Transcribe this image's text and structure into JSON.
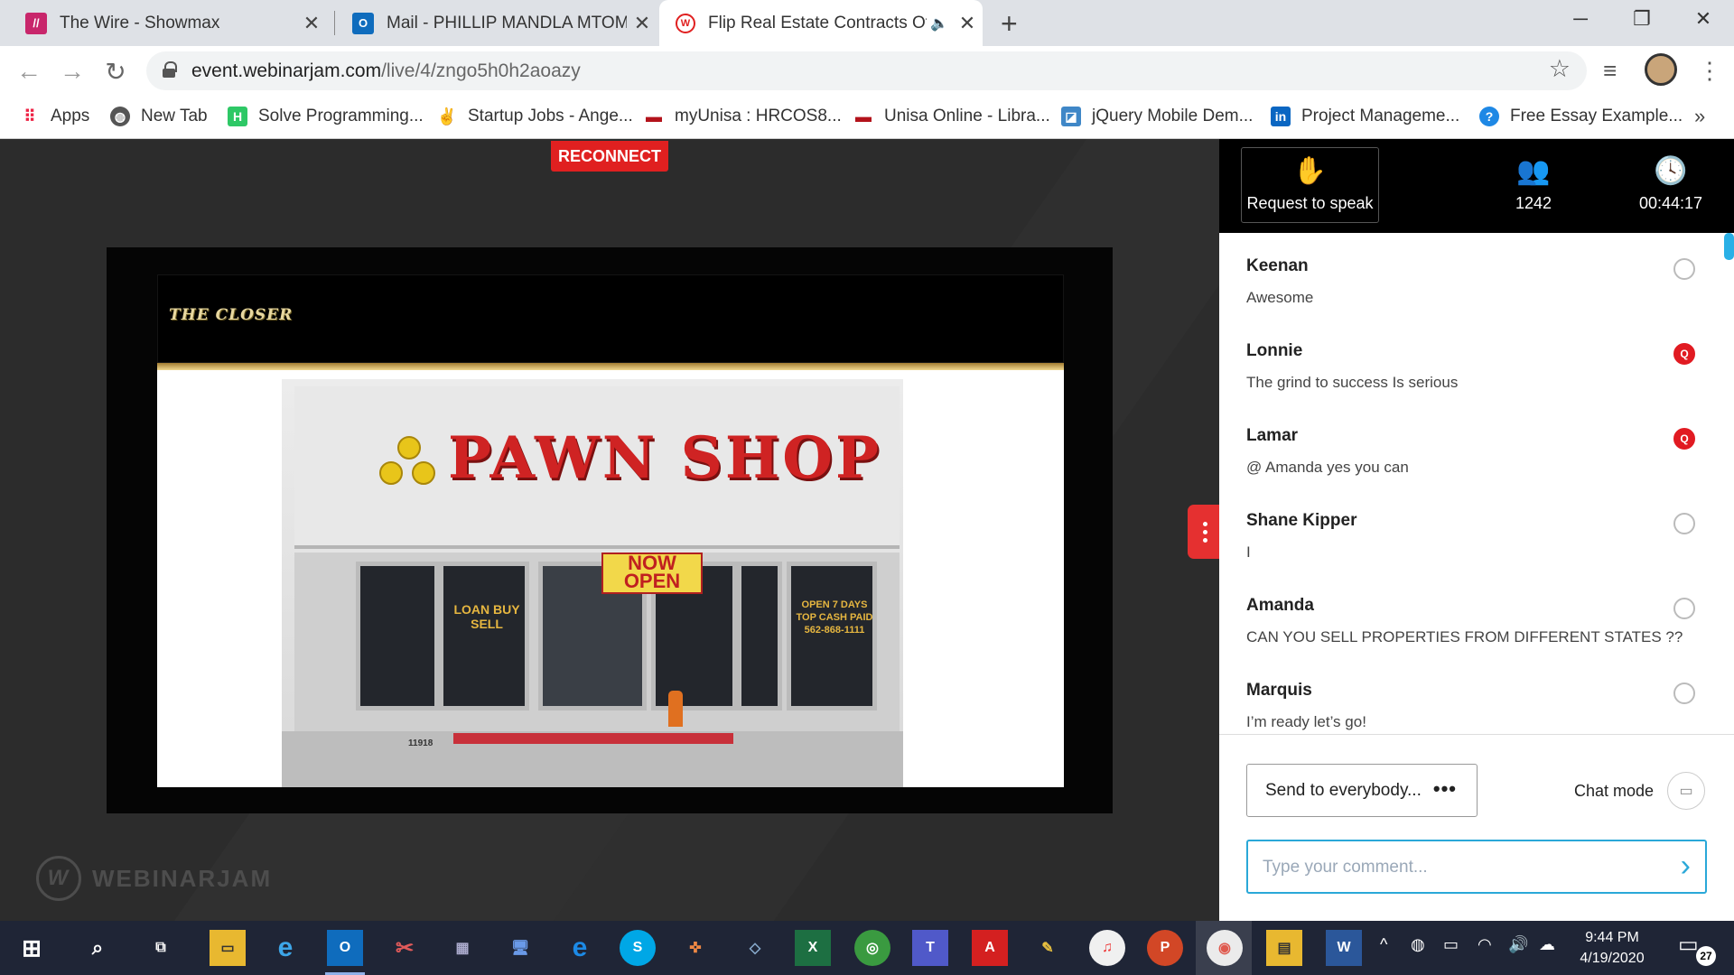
{
  "browser": {
    "tabs": [
      {
        "title": "The Wire - Showmax",
        "icon": "showmax-icon",
        "color": "#c8266b"
      },
      {
        "title": "Mail - PHILLIP MANDLA MTOMBENI",
        "icon": "outlook-icon",
        "color": "#0f6cbd"
      },
      {
        "title": "Flip Real Estate Contracts Of",
        "icon": "webinarjam-icon",
        "color": "#e02020",
        "active": true
      }
    ],
    "new_tab_label": "+",
    "url_domain": "event.webinarjam.com",
    "url_path": "/live/4/zngo5h0h2aoazy",
    "bookmarks": [
      {
        "label": "Apps",
        "icon": "apps-grid-icon",
        "color": "#4285f4"
      },
      {
        "label": "New Tab",
        "icon": "globe-icon",
        "color": "#555555"
      },
      {
        "label": "Solve Programming...",
        "icon": "hackerrank-icon",
        "color": "#2ec866"
      },
      {
        "label": "Startup Jobs - Ange...",
        "icon": "angellist-icon",
        "color": "#333333"
      },
      {
        "label": "myUnisa : HRCOS8...",
        "icon": "unisa-icon",
        "color": "#b3131b"
      },
      {
        "label": "Unisa Online - Libra...",
        "icon": "unisa-icon",
        "color": "#b3131b"
      },
      {
        "label": "jQuery Mobile Dem...",
        "icon": "jquery-icon",
        "color": "#3f87c7"
      },
      {
        "label": "Project Manageme...",
        "icon": "linkedin-icon",
        "color": "#0a66c2"
      },
      {
        "label": "Free Essay Example...",
        "icon": "essay-icon",
        "color": "#1e88e5"
      }
    ]
  },
  "webinar": {
    "reconnect_label": "RECONNECT",
    "slide": {
      "show_title": "THE CLOSER",
      "store_sign": "PAWN SHOP",
      "now_open": "NOW OPEN",
      "left_window": "LOAN BUY SELL",
      "right_window": "OPEN 7 DAYS TOP CASH PAID 562-868-1111",
      "address": "11918"
    },
    "brand": "WEBINARJAM",
    "header": {
      "request_label": "Request to speak",
      "attendees": "1242",
      "elapsed": "00:44:17"
    },
    "chat": [
      {
        "name": "Keenan",
        "text": "Awesome",
        "q": false
      },
      {
        "name": "Lonnie",
        "text": "The grind to success Is serious",
        "q": true
      },
      {
        "name": "Lamar",
        "text": "@ Amanda yes you can",
        "q": true
      },
      {
        "name": "Shane Kipper",
        "text": "I",
        "q": false
      },
      {
        "name": "Amanda",
        "text": "CAN YOU SELL PROPERTIES FROM DIFFERENT STATES ??",
        "q": false
      },
      {
        "name": "Marquis",
        "text": "I’m ready let’s go!",
        "q": false
      }
    ],
    "question_badge": "Q",
    "send_to": "Send to everybody...",
    "chat_mode_label": "Chat mode",
    "comment_placeholder": "Type your comment..."
  },
  "taskbar": {
    "time": "9:44 PM",
    "date": "4/19/2020",
    "notifications": "27"
  }
}
